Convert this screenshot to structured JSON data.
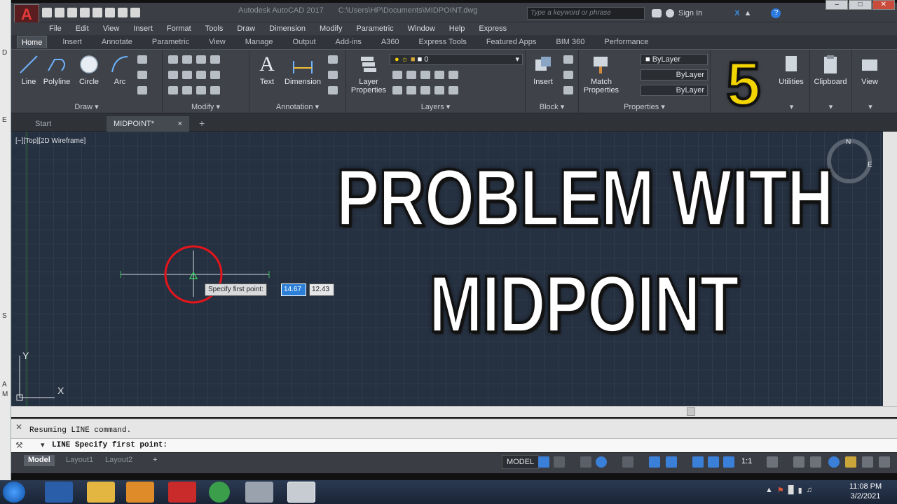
{
  "window": {
    "app_title": "Autodesk AutoCAD 2017",
    "file_path": "C:\\Users\\HP\\Documents\\MIDPOINT.dwg",
    "search_placeholder": "Type a keyword or phrase",
    "sign_in": "Sign In"
  },
  "menu": [
    "File",
    "Edit",
    "View",
    "Insert",
    "Format",
    "Tools",
    "Draw",
    "Dimension",
    "Modify",
    "Parametric",
    "Window",
    "Help",
    "Express"
  ],
  "ribbon_tabs": [
    {
      "label": "Home",
      "active": true
    },
    {
      "label": "Insert"
    },
    {
      "label": "Annotate"
    },
    {
      "label": "Parametric"
    },
    {
      "label": "View"
    },
    {
      "label": "Manage"
    },
    {
      "label": "Output"
    },
    {
      "label": "Add-ins"
    },
    {
      "label": "A360"
    },
    {
      "label": "Express Tools"
    },
    {
      "label": "Featured Apps"
    },
    {
      "label": "BIM 360"
    },
    {
      "label": "Performance"
    }
  ],
  "ribbon": {
    "draw": {
      "title": "Draw",
      "tools": [
        "Line",
        "Polyline",
        "Circle",
        "Arc"
      ]
    },
    "modify": {
      "title": "Modify"
    },
    "annotation": {
      "title": "Annotation",
      "tools": [
        "Text",
        "Dimension"
      ]
    },
    "layers": {
      "title": "Layers",
      "tool_line1": "Layer",
      "tool_line2": "Properties",
      "layer_value": "0"
    },
    "block": {
      "title": "Block",
      "tool": "Insert"
    },
    "properties": {
      "title": "Properties",
      "match_line1": "Match",
      "match_line2": "Properties",
      "color": "ByLayer",
      "linetype": "ByLayer",
      "lineweight": "ByLayer"
    },
    "utilities": "Utilities",
    "clipboard": "Clipboard",
    "view": "View"
  },
  "doc_tabs": {
    "start": "Start",
    "active": "MIDPOINT*"
  },
  "viewport": {
    "label": "[−][Top][2D Wireframe]",
    "tooltip": "Specify first point:",
    "coord_x": "14.67",
    "coord_y": "12.43",
    "compass_n": "N",
    "compass_e": "E",
    "ucs_y": "Y",
    "ucs_x": "X"
  },
  "command": {
    "history": "Resuming LINE command.",
    "prompt": "LINE Specify first point:"
  },
  "layout_tabs": [
    "Model",
    "Layout1",
    "Layout2"
  ],
  "status": {
    "model": "MODEL",
    "scale": "1:1"
  },
  "overlay": {
    "line1": "PROBLEM WITH",
    "line2": "MIDPOINT",
    "badge": "5"
  },
  "clock": {
    "time": "11:08 PM",
    "date": "3/2/2021"
  },
  "left_strip_letters": [
    "D",
    "E",
    "S",
    "A",
    "M"
  ]
}
